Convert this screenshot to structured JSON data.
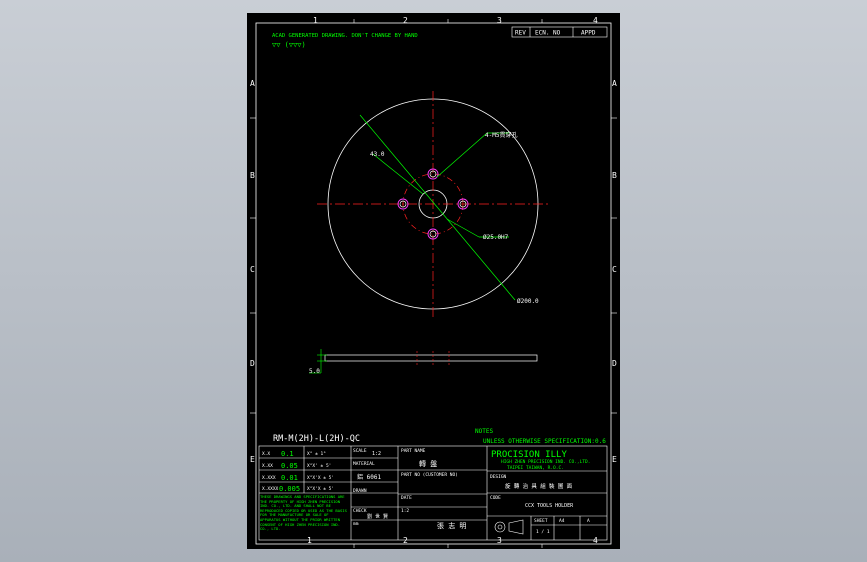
{
  "drawing": {
    "header_note": "ACAD GENERATED DRAWING. DON'T CHANGE BY HAND",
    "surface_symbols": "▽▽ (▽▽▽)",
    "rev_columns": [
      "REV",
      "ECN. NO",
      "APPD"
    ],
    "col_labels": [
      "1",
      "2",
      "3",
      "4"
    ],
    "row_labels": [
      "A",
      "B",
      "C",
      "D",
      "E"
    ],
    "callouts": {
      "holes": "4-M5貫穿孔",
      "pcd": "43.0",
      "bore": "Ø25.0H7",
      "outer": "Ø200.0",
      "thickness": "5.0"
    },
    "part_number": "RM-M(2H)-L(2H)-QC",
    "notes": {
      "title": "NOTES",
      "general": "UNLESS OTHERWISE SPECIFICATION:0.6"
    },
    "tolerances": [
      {
        "place": "X.X",
        "value": "0.1",
        "angle": "X°  ± 1°"
      },
      {
        "place": "X.XX",
        "value": "0.05",
        "angle": "X°X' ± 5'"
      },
      {
        "place": "X.XXX",
        "value": "0.01",
        "angle": "X°X'X ± 5'"
      },
      {
        "place": "X.XXXX",
        "value": "0.005",
        "angle": "X°X'X ± 5'"
      }
    ],
    "title_block": {
      "scale_label": "SCALE",
      "scale_value": "1:2",
      "material_label": "MATERIAL",
      "material_value": "鋁 6061",
      "drawn_label": "DRAWN",
      "drawn_value": "張 志 明",
      "part_name_label": "PART NAME",
      "part_name_value": "轉 盤",
      "part_no_label": "PART NO (CUSTOMER NO)",
      "design_label": "DESIGN",
      "design_value": "旋 轉 治 具 組 裝 圖 面",
      "company_logo": "PROCISION ILLY",
      "company_name": "HIGH ZHEN PRECISION IND. CO.,LTD.",
      "company_city": "TAIPEI TAIWAN, R.O.C.",
      "code_label": "CODE",
      "code_value": "CCX TOOLS HOLDER",
      "sheet_label": "SHEET",
      "sheet_value": "1 / 1",
      "date_label": "DATE",
      "date_value": "1:2",
      "unit": "mm",
      "check_label": "CHECK",
      "check_value": "劉 世 賢",
      "size": "A4",
      "rev": "A",
      "proprietary": "THESE DRAWINGS AND SPECIFICATIONS ARE THE PROPERTY OF HIGH ZHEN PRECISION IND. CO., LTD. AND SHALL NOT BE REPRODUCED COPIED OR USED AS THE BASIS FOR THE MANUFACTURE OR SALE OF APPARATUS WITHOUT THE PRIOR WRITTEN CONSENT OF HIGH ZHEN PRECISION IND. CO., LTD."
    }
  }
}
